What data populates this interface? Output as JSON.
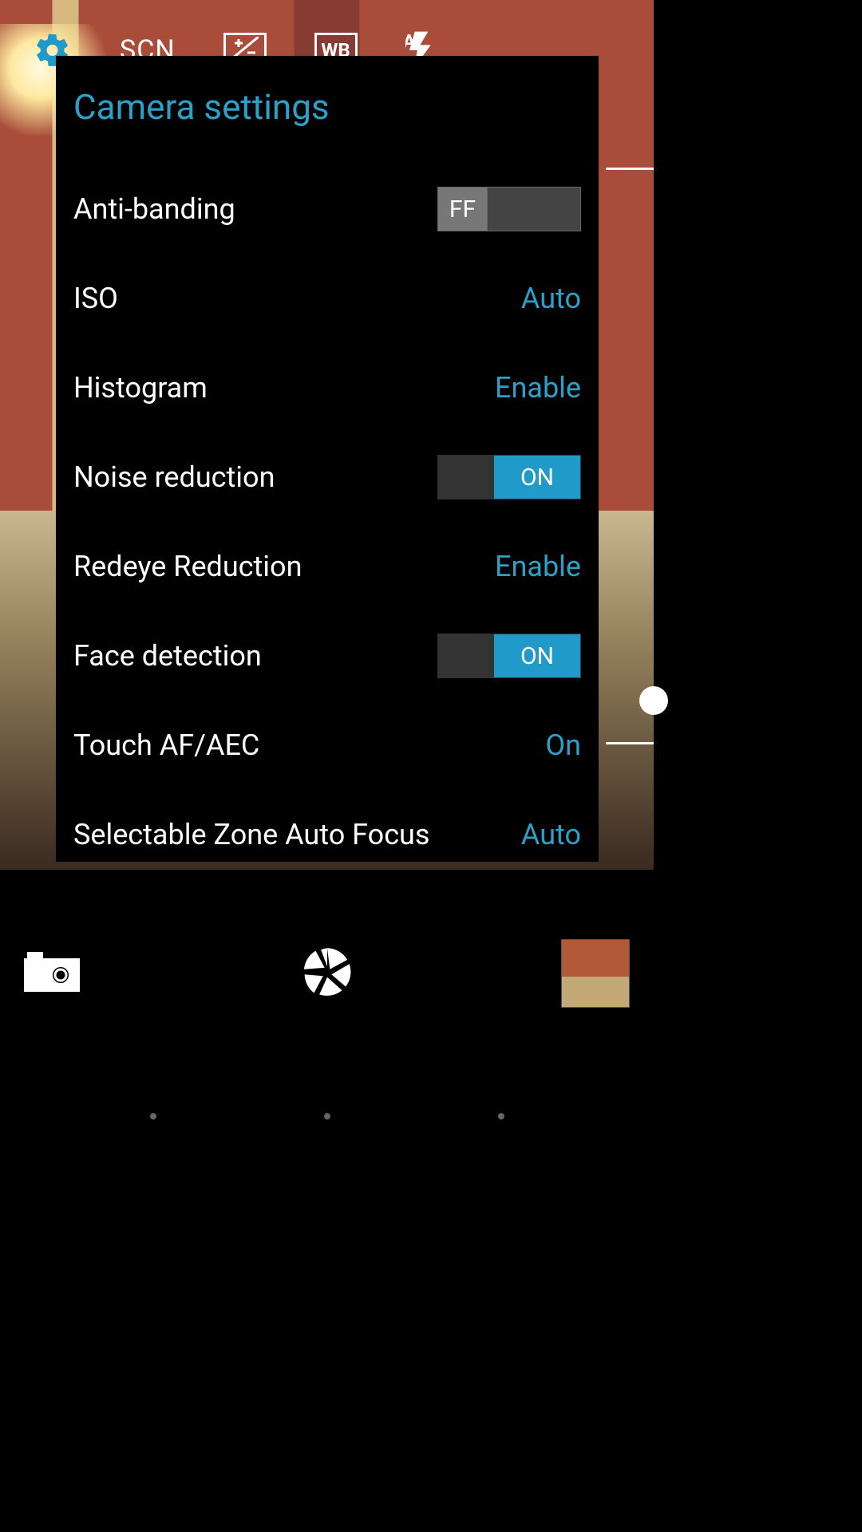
{
  "accent_color": "#2da0c8",
  "toolbar": {
    "scene": "SCN",
    "exposure_icon": "+/-",
    "wb_icon": "WB"
  },
  "settings": {
    "title": "Camera settings",
    "rows": {
      "anti_banding": {
        "label": "Anti-banding",
        "box_value": "FF"
      },
      "iso": {
        "label": "ISO",
        "value": "Auto"
      },
      "histogram": {
        "label": "Histogram",
        "value": "Enable"
      },
      "noise_reduction": {
        "label": "Noise reduction",
        "toggle": "ON"
      },
      "redeye": {
        "label": "Redeye Reduction",
        "value": "Enable"
      },
      "face_detection": {
        "label": "Face detection",
        "toggle": "ON"
      },
      "touch_af_aec": {
        "label": "Touch AF/AEC",
        "value": "On"
      },
      "zone_af": {
        "label": "Selectable Zone Auto Focus",
        "value": "Auto"
      }
    }
  }
}
